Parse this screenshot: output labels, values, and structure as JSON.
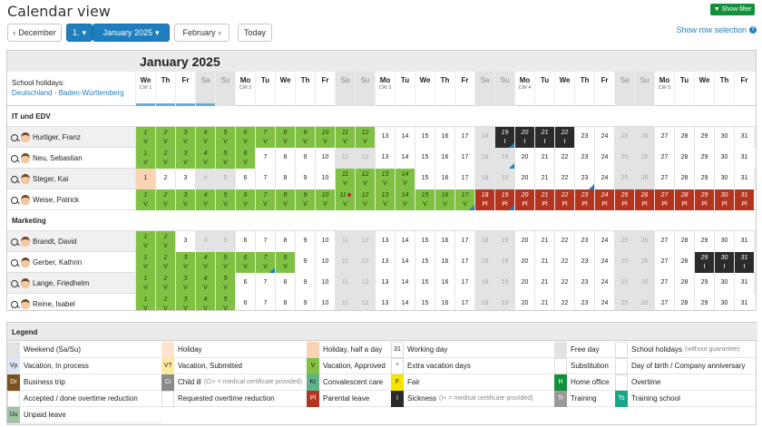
{
  "title": "Calendar view",
  "toolbar": {
    "prev": "December",
    "period": "1.",
    "month": "January 2025",
    "next": "February",
    "today": "Today",
    "filter": "Show filter",
    "row_selection": "Show row selection"
  },
  "month_title": "January 2025",
  "holidays": {
    "label": "School holidays:",
    "link": "Deutschland - Baden-Württemberg"
  },
  "days": [
    {
      "n": "We",
      "cw": "CW 1"
    },
    {
      "n": "Th"
    },
    {
      "n": "Fr"
    },
    {
      "n": "Sa",
      "we": true
    },
    {
      "n": "Su",
      "we": true
    },
    {
      "n": "Mo",
      "cw": "CW 2"
    },
    {
      "n": "Tu"
    },
    {
      "n": "We"
    },
    {
      "n": "Th"
    },
    {
      "n": "Fr"
    },
    {
      "n": "Sa",
      "we": true
    },
    {
      "n": "Su",
      "we": true
    },
    {
      "n": "Mo",
      "cw": "CW 3"
    },
    {
      "n": "Tu"
    },
    {
      "n": "We"
    },
    {
      "n": "Th"
    },
    {
      "n": "Fr"
    },
    {
      "n": "Sa",
      "we": true
    },
    {
      "n": "Su",
      "we": true
    },
    {
      "n": "Mo",
      "cw": "CW 4"
    },
    {
      "n": "Tu"
    },
    {
      "n": "We"
    },
    {
      "n": "Th"
    },
    {
      "n": "Fr"
    },
    {
      "n": "Sa",
      "we": true
    },
    {
      "n": "Su",
      "we": true
    },
    {
      "n": "Mo",
      "cw": "CW 5"
    },
    {
      "n": "Tu"
    },
    {
      "n": "We"
    },
    {
      "n": "Th"
    },
    {
      "n": "Fr"
    }
  ],
  "groups": [
    {
      "name": "IT und EDV",
      "people": [
        {
          "name": "Hurtiger, Franz",
          "cells": {
            "v": [
              1,
              2,
              3,
              4,
              5,
              6,
              7,
              8,
              9,
              10,
              11,
              12
            ],
            "dark": [
              19,
              20,
              21,
              22
            ],
            "darkcode": "I",
            "mk": [
              19
            ]
          }
        },
        {
          "name": "Neu, Sebastian",
          "cells": {
            "v": [
              1,
              2,
              3,
              4,
              5,
              6
            ],
            "mk": [
              19
            ]
          }
        },
        {
          "name": "Steger, Kai",
          "cells": {
            "half": [
              1
            ],
            "v": [
              11,
              12,
              13,
              14
            ],
            "mk": [
              23
            ]
          }
        },
        {
          "name": "Weise, Patrick",
          "cells": {
            "v": [
              1,
              2,
              3,
              4,
              5,
              6,
              7,
              8,
              9,
              10,
              11,
              12,
              13,
              14,
              15,
              16,
              17
            ],
            "pl": [
              18,
              19,
              20,
              21,
              22,
              23,
              24,
              25,
              26,
              27,
              28,
              29,
              30,
              31
            ],
            "mk": [
              17,
              19
            ],
            "bday": [
              11
            ]
          }
        }
      ]
    },
    {
      "name": "Marketing",
      "people": [
        {
          "name": "Brandt, David",
          "cells": {
            "v": [
              1,
              2
            ],
            "mk": []
          }
        },
        {
          "name": "Gerber, Kathrin",
          "cells": {
            "v": [
              1,
              2,
              3,
              4,
              5,
              6,
              7,
              8
            ],
            "dark": [
              29,
              30,
              31
            ],
            "darkcode": "I",
            "mk": [
              7
            ]
          }
        },
        {
          "name": "Lange, Friedhelm",
          "cells": {
            "v": [
              1,
              2,
              3,
              4,
              5
            ],
            "mk": []
          }
        },
        {
          "name": "Reine, Isabel",
          "cells": {
            "v": [
              1,
              2,
              3,
              4,
              5
            ],
            "mk": []
          }
        }
      ]
    }
  ],
  "legend": {
    "title": "Legend",
    "items": [
      {
        "code": "",
        "label": "Weekend (Sa/Su)",
        "color": "#e3e3e3"
      },
      {
        "code": "",
        "label": "Holiday",
        "color": "#fbe3cf"
      },
      {
        "code": "",
        "label": "Holiday, half a day",
        "color": "#fbd3b5"
      },
      {
        "code": "31",
        "label": "Working day",
        "color": "#ffffff"
      },
      {
        "code": "",
        "label": "Free day",
        "color": "#e3e3e3"
      },
      {
        "code": "",
        "label": "School holidays",
        "note": "(without guarantee)",
        "color": "#ffffff"
      },
      {
        "code": "Vp",
        "label": "Vacation, In process",
        "color": "#dfe6f7"
      },
      {
        "code": "V?",
        "label": "Vacation, Submitted",
        "color": "#fdeaa1"
      },
      {
        "code": "V",
        "label": "Vacation, Approved",
        "color": "#7fc243"
      },
      {
        "code": "*",
        "label": "Extra vacation days",
        "color": "#ffffff"
      },
      {
        "code": "",
        "label": "Substitution",
        "color": "#ffffff"
      },
      {
        "code": "",
        "label": "Day of birth / Company anniversary",
        "color": "#ffffff"
      },
      {
        "code": "Dr",
        "label": "Business trip",
        "color": "#7a5320"
      },
      {
        "code": "Ci",
        "label": "Child ill",
        "note": "(Ci+ = medical certificate provided)",
        "color": "#8a8a8a"
      },
      {
        "code": "Kr",
        "label": "Convalescent care",
        "color": "#5fb38a"
      },
      {
        "code": "F",
        "label": "Fair",
        "color": "#f5e400"
      },
      {
        "code": "H",
        "label": "Home office",
        "color": "#13913a"
      },
      {
        "code": "",
        "label": "Overtime",
        "color": "#ffffff"
      },
      {
        "code": "",
        "label": "Accepted / done overtime reduction",
        "color": "#ffffff"
      },
      {
        "code": "",
        "label": "Requested overtime reduction",
        "color": "#ffffff"
      },
      {
        "code": "Pl",
        "label": "Parental leave",
        "color": "#b3341f"
      },
      {
        "code": "I",
        "label": "Sickness",
        "note": "(I+ = medical certificate provided)",
        "color": "#2b2b2b"
      },
      {
        "code": "Tr",
        "label": "Training",
        "color": "#9a9a9a"
      },
      {
        "code": "Ts",
        "label": "Training school",
        "color": "#18a58a"
      },
      {
        "code": "Uu",
        "label": "Unpaid leave",
        "color": "#9fc3a6"
      }
    ]
  }
}
